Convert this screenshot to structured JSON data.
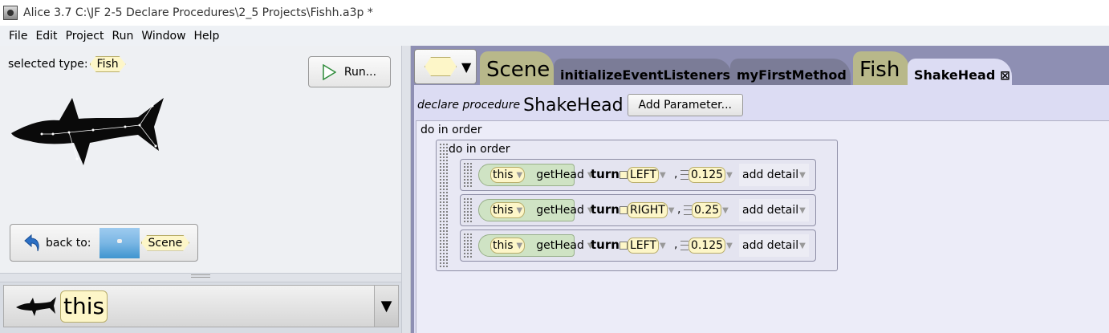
{
  "window": {
    "title": "Alice 3.7 C:\\JF 2-5 Declare Procedures\\2_5 Projects\\Fishh.a3p *"
  },
  "menu": {
    "items": [
      "File",
      "Edit",
      "Project",
      "Run",
      "Window",
      "Help"
    ]
  },
  "left_panel": {
    "selected_type_label": "selected type:",
    "selected_type": "Fish",
    "run_label": "Run...",
    "back_label": "back to:",
    "back_target": "Scene",
    "instance_name": "this"
  },
  "tabs": [
    {
      "label": "Scene",
      "kind": "type"
    },
    {
      "label": "initializeEventListeners",
      "kind": "method"
    },
    {
      "label": "myFirstMethod",
      "kind": "method"
    },
    {
      "label": "Fish",
      "kind": "type"
    },
    {
      "label": "ShakeHead",
      "kind": "method",
      "active": true,
      "closable": true
    }
  ],
  "editor": {
    "declare_label": "declare procedure",
    "procedure_name": "ShakeHead",
    "add_parameter_label": "Add Parameter...",
    "outer_block_label": "do in order",
    "inner_block_label": "do in order",
    "statements": [
      {
        "target": "this",
        "method": "getHead",
        "action": "turn",
        "direction": "LEFT",
        "amount": "0.125",
        "detail": "add detail"
      },
      {
        "target": "this",
        "method": "getHead",
        "action": "turn",
        "direction": "RIGHT",
        "amount": "0.25",
        "detail": "add detail"
      },
      {
        "target": "this",
        "method": "getHead",
        "action": "turn",
        "direction": "LEFT",
        "amount": "0.125",
        "detail": "add detail"
      }
    ]
  },
  "colors": {
    "tile_yellow": "#fdf6c8",
    "expression_green": "#cfe3c4",
    "editor_bg": "#dcdcf3",
    "tab_bar_bg": "#8e8fb3"
  }
}
